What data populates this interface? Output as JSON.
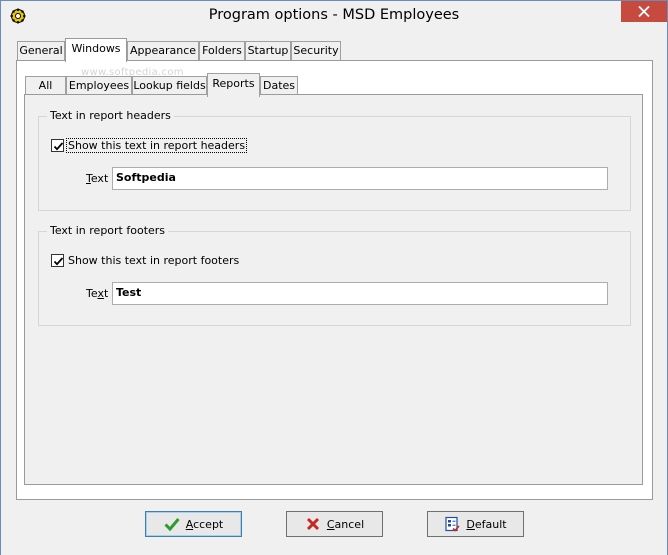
{
  "window": {
    "title": "Program options - MSD Employees"
  },
  "outer_tabs": [
    {
      "label": "General"
    },
    {
      "label": "Windows"
    },
    {
      "label": "Appearance"
    },
    {
      "label": "Folders"
    },
    {
      "label": "Startup"
    },
    {
      "label": "Security"
    }
  ],
  "outer_tabs_selected": "Windows",
  "inner_tabs": [
    {
      "label": "All"
    },
    {
      "label": "Employees"
    },
    {
      "label": "Lookup fields"
    },
    {
      "label": "Reports"
    },
    {
      "label": "Dates"
    }
  ],
  "inner_tabs_selected": "Reports",
  "headers_group": {
    "legend": "Text in report headers",
    "checkbox_label": "Show this text in report headers",
    "checked": true,
    "field_label_prefix": "",
    "field_label_mnemonic": "T",
    "field_label_rest": "ext",
    "value": "Softpedia"
  },
  "footers_group": {
    "legend": "Text in report footers",
    "checkbox_label": "Show this text in report footers",
    "checked": true,
    "field_label_prefix": "Te",
    "field_label_mnemonic": "x",
    "field_label_rest": "t",
    "value": "Test"
  },
  "buttons": {
    "accept": {
      "mnemonic": "A",
      "rest": "ccept"
    },
    "cancel": {
      "mnemonic": "C",
      "rest": "ancel"
    },
    "default": {
      "mnemonic": "D",
      "rest": "efault"
    }
  },
  "watermark": "www.softpedia.com",
  "colors": {
    "close_button": "#c74a3f",
    "accept_icon": "#2e9b2e",
    "cancel_icon": "#c62828"
  },
  "icons": {
    "app": "gear-icon",
    "close": "close-icon",
    "accept": "checkmark-icon",
    "cancel": "x-icon",
    "default": "defaults-icon"
  }
}
